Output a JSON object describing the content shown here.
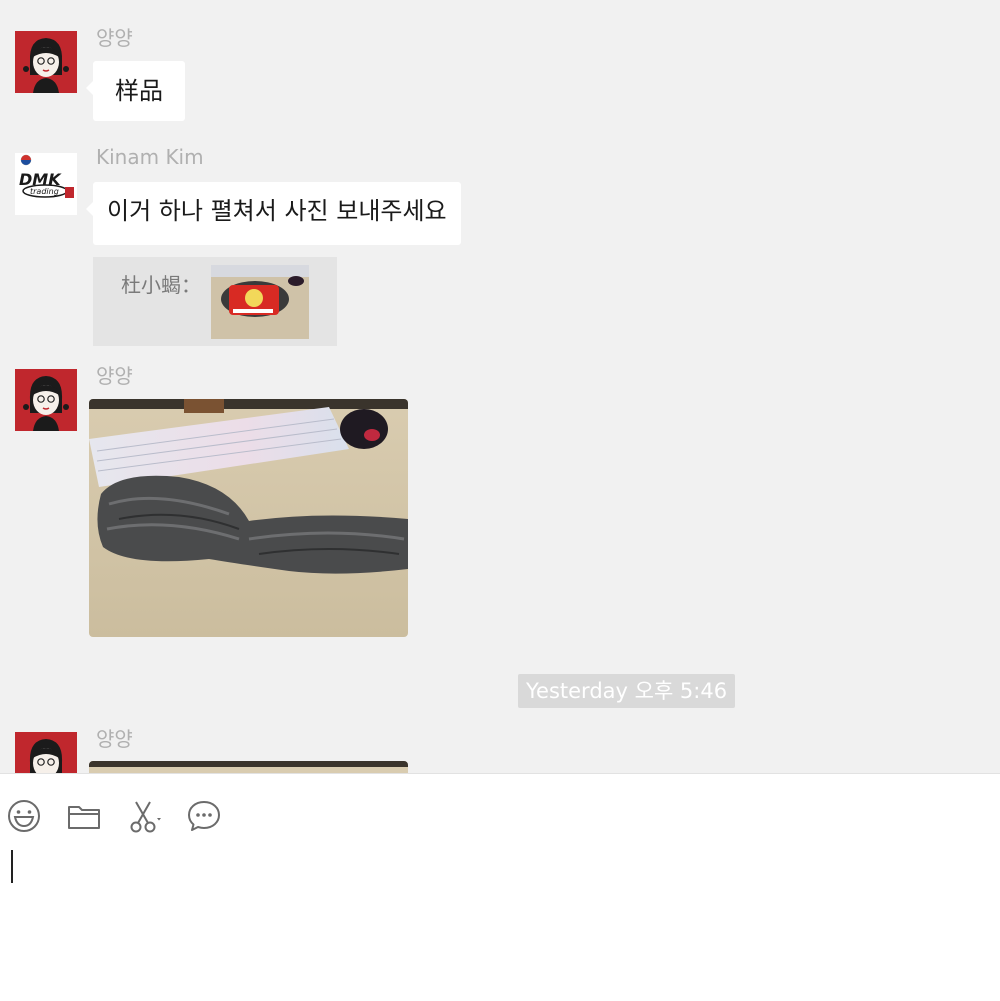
{
  "messages": [
    {
      "sender": "양양",
      "text": "样品"
    },
    {
      "sender": "Kinam Kim",
      "text": "이거 하나 펼쳐서 사진 보내주세요",
      "quote": {
        "label": "杜小蝎："
      }
    },
    {
      "sender": "양양",
      "type": "image"
    },
    {
      "sender": "양양",
      "type": "image"
    }
  ],
  "timestamp": "Yesterday 오후 5:46",
  "avatar_kinam": {
    "logo_text": "DMK",
    "logo_sub": "trading",
    "flag": "korea-flag-icon"
  },
  "toolbar": {
    "icons": [
      "emoji-icon",
      "folder-icon",
      "scissors-icon",
      "chat-bubble-icon"
    ]
  },
  "input": {
    "value": ""
  },
  "colors": {
    "chat_background": "#f1f1f1",
    "bubble": "#ffffff",
    "avatar_red": "#c0272d",
    "timestamp_bg": "#d9d9d9"
  }
}
